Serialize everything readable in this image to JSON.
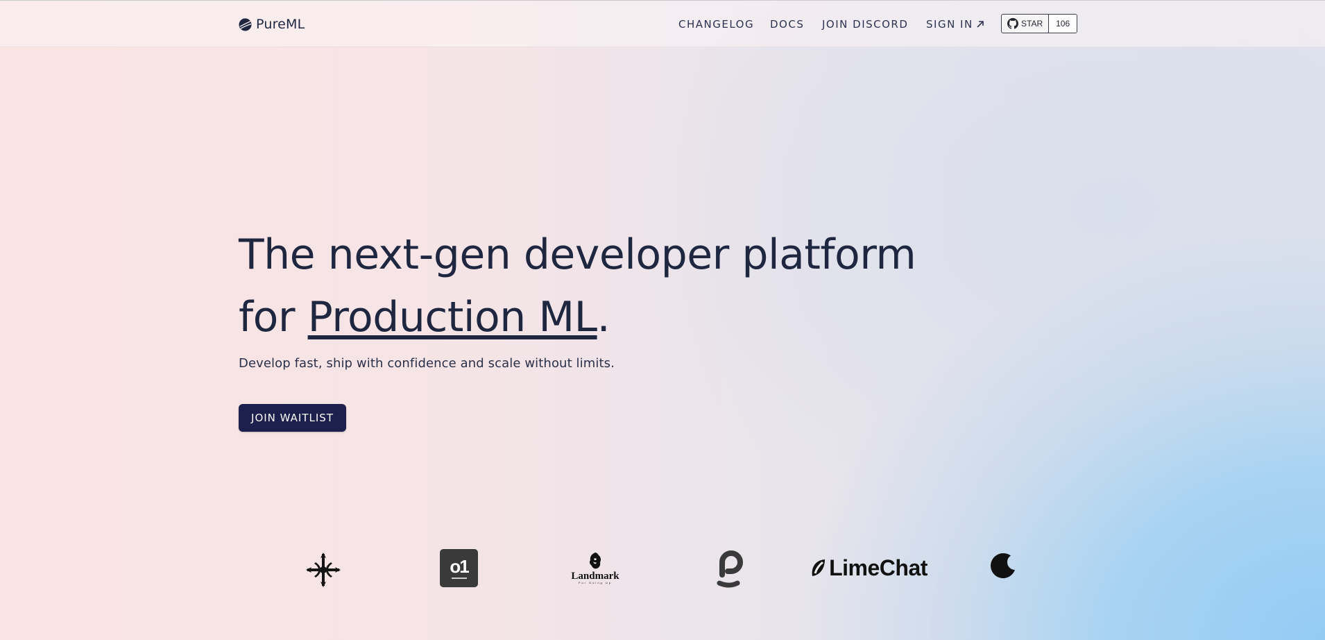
{
  "header": {
    "logo_text": "PureML",
    "nav": {
      "changelog": "CHANGELOG",
      "docs": "DOCS",
      "discord": "JOIN DISCORD",
      "signin": "SIGN IN"
    },
    "github": {
      "star_label": "STAR",
      "star_count": "106"
    }
  },
  "hero": {
    "title_part1": "The next-gen developer platform for ",
    "title_highlight": "Production ML",
    "title_end": ".",
    "subtitle": "Develop fast, ship with confidence and scale without limits.",
    "cta_label": "JOIN WAITLIST"
  },
  "partners": {
    "landmark": "Landmark",
    "landmark_tagline": "For Going Up",
    "limechat": "LimeChat",
    "o1_logo": "o1"
  },
  "colors": {
    "primary_text": "#1e2640",
    "cta_background": "#1d1f4d",
    "gradient_pink": "#fbe4e4",
    "gradient_blue": "#93cbf4"
  }
}
